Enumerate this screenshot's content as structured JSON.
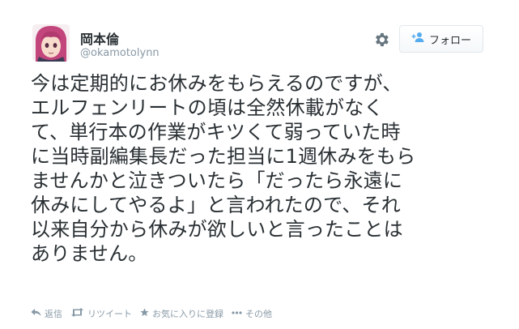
{
  "user": {
    "display_name": "岡本倫",
    "handle": "@okamotolynn"
  },
  "header": {
    "follow_label": "フォロー",
    "gear_icon": "gear-icon",
    "follow_icon": "add-user-icon"
  },
  "tweet": {
    "text": "今は定期的にお休みをもらえるのですが、\nエルフェンリートの頃は全然休載がなく\nて、単行本の作業がキツくて弱っていた時\nに当時副編集長だった担当に1週休みをもら\nませんかと泣きついたら「だったら永遠に\n休みにしてやるよ」と言われたので、それ\n以来自分から休みが欲しいと言ったことは\nありません。"
  },
  "actions": {
    "reply_label": "返信",
    "retweet_label": "リツイート",
    "favorite_label": "お気に入りに登録",
    "more_label": "その他"
  },
  "colors": {
    "text": "#292f33",
    "muted": "#8899a6",
    "border": "#e1e8ed"
  }
}
